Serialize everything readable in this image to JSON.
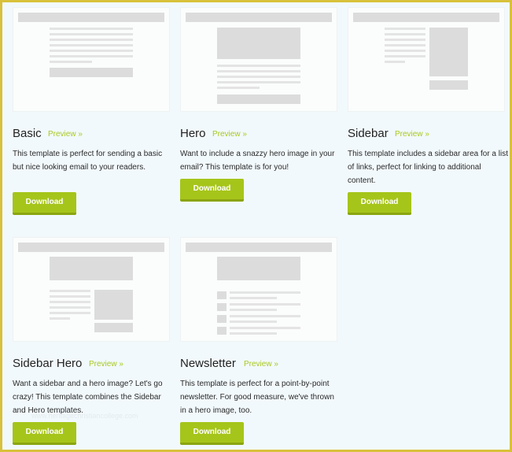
{
  "templates": [
    {
      "name": "Basic",
      "preview": "Preview »",
      "description": "This template is perfect for sending a basic but nice looking email to your readers.",
      "button": "Download"
    },
    {
      "name": "Hero",
      "preview": "Preview »",
      "description": "Want to include a snazzy hero image in your email? This template is for you!",
      "button": "Download"
    },
    {
      "name": "Sidebar",
      "preview": "Preview »",
      "description": "This template includes a sidebar area for a list of links, perfect for linking to additional content.",
      "button": "Download"
    },
    {
      "name": "Sidebar Hero",
      "preview": "Preview »",
      "description": "Want a sidebar and a hero image? Let's go crazy! This template combines the Sidebar and Hero templates.",
      "button": "Download"
    },
    {
      "name": "Newsletter",
      "preview": "Preview »",
      "description": "This template is perfect for a point-by-point newsletter. For good measure, we've thrown in a hero image, too.",
      "button": "Download"
    }
  ],
  "watermark": "www.heritagechristiancollege.com",
  "colors": {
    "accent": "#a6c51a",
    "link": "#a8c920",
    "border": "#d8c13a",
    "background": "#f2f9fc"
  }
}
